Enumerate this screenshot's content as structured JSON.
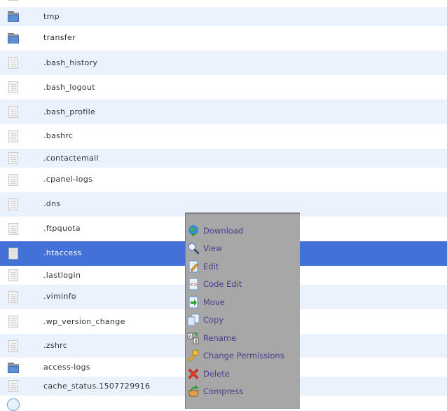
{
  "file_list": {
    "rows": [
      {
        "name": "",
        "type": "file",
        "state": "white"
      },
      {
        "name": "tmp",
        "type": "folder",
        "state": "alt"
      },
      {
        "name": "transfer",
        "type": "folder",
        "state": "white"
      },
      {
        "name": ".bash_history",
        "type": "file",
        "state": "alt"
      },
      {
        "name": ".bash_logout",
        "type": "file",
        "state": "white"
      },
      {
        "name": ".bash_profile",
        "type": "file",
        "state": "alt"
      },
      {
        "name": ".bashrc",
        "type": "file",
        "state": "white"
      },
      {
        "name": ".contactemail",
        "type": "file",
        "state": "alt"
      },
      {
        "name": ".cpanel-logs",
        "type": "file",
        "state": "white"
      },
      {
        "name": ".dns",
        "type": "file",
        "state": "alt"
      },
      {
        "name": ".ftpquota",
        "type": "file",
        "state": "white"
      },
      {
        "name": ".htaccess",
        "type": "file",
        "state": "selected"
      },
      {
        "name": ".lastlogin",
        "type": "file",
        "state": "white"
      },
      {
        "name": ".viminfo",
        "type": "file",
        "state": "alt"
      },
      {
        "name": ".wp_version_change",
        "type": "file",
        "state": "white"
      },
      {
        "name": ".zshrc",
        "type": "file",
        "state": "alt"
      },
      {
        "name": "access-logs",
        "type": "folder",
        "state": "white"
      },
      {
        "name": "cache_status.1507729916",
        "type": "file",
        "state": "alt"
      }
    ]
  },
  "context_menu": {
    "items": [
      {
        "label": "Download",
        "icon": "download-globe-icon"
      },
      {
        "label": "View",
        "icon": "magnifier-icon"
      },
      {
        "label": "Edit",
        "icon": "edit-pencil-icon"
      },
      {
        "label": "Code Edit",
        "icon": "code-edit-icon"
      },
      {
        "label": "Move",
        "icon": "move-arrow-icon"
      },
      {
        "label": "Copy",
        "icon": "copy-icon"
      },
      {
        "label": "Rename",
        "icon": "rename-icon"
      },
      {
        "label": "Change Permissions",
        "icon": "key-icon"
      },
      {
        "label": "Delete",
        "icon": "delete-x-icon"
      },
      {
        "label": "Compress",
        "icon": "compress-box-icon"
      }
    ]
  },
  "colors": {
    "row_alt": "#eaf3fd",
    "row_selected": "#4271d8",
    "menu_bg": "#a7a7a7",
    "menu_text": "#4b3c8c"
  }
}
